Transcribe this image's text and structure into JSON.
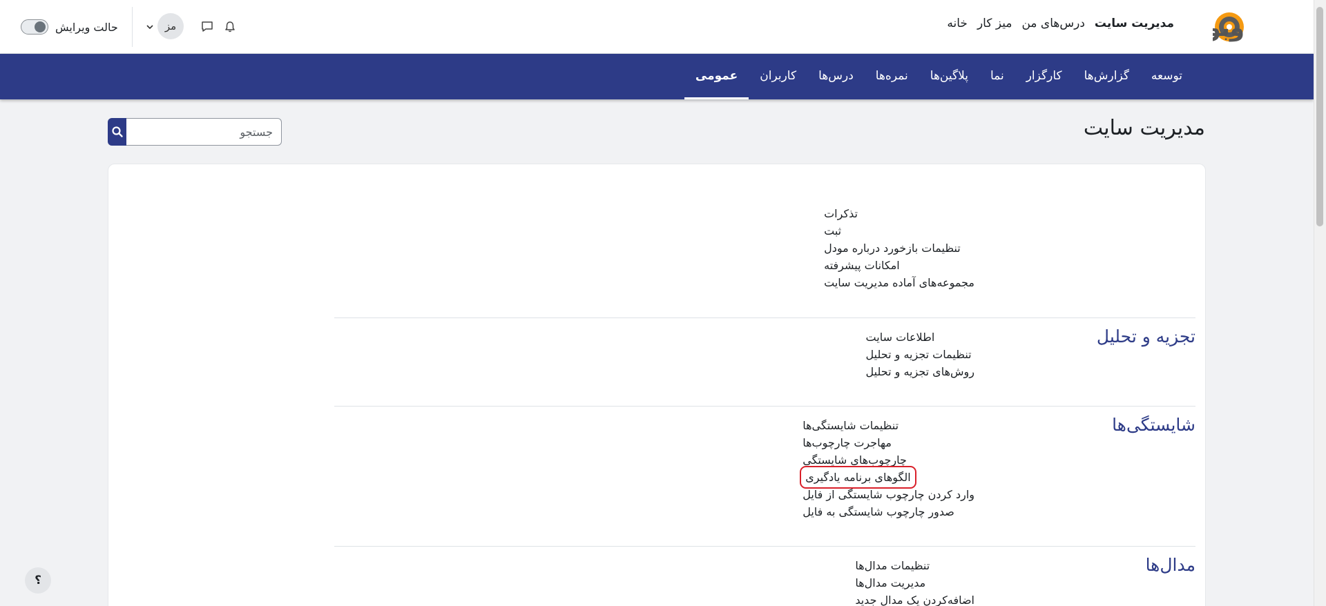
{
  "topbar": {
    "brand": "وبو",
    "nav": [
      "خانه",
      "میز کار",
      "درس‌های من",
      "مدیریت سایت"
    ],
    "nav_active_index": 3,
    "avatar_initials": "مز",
    "edit_mode_label": "حالت ویرایش"
  },
  "secondary_nav": {
    "tabs": [
      "عمومی",
      "کاربران",
      "درس‌ها",
      "نمره‌ها",
      "پلاگین‌ها",
      "نما",
      "کارگزار",
      "گزارش‌ها",
      "توسعه"
    ],
    "active_index": 0
  },
  "page": {
    "title": "مدیریت سایت",
    "search_placeholder": "جستجو"
  },
  "sections": [
    {
      "title": "",
      "links": [
        "تذکرات",
        "ثبت",
        "تنظیمات بازخورد درباره مودل",
        "امکانات پیشرفته",
        "مجموعه‌های آماده مدیریت سایت"
      ]
    },
    {
      "title": "تجزیه و تحلیل",
      "links": [
        "اطلاعات سایت",
        "تنظیمات تجزیه و تحلیل",
        "روش‌های تجزیه و تحلیل"
      ]
    },
    {
      "title": "شایستگی‌ها",
      "links": [
        "تنظیمات شایستگی‌ها",
        "مهاجرت چارچوب‌ها",
        "چارچوب‌های شایستگی",
        "الگوهای برنامه یادگیری",
        "وارد کردن چارچوب شایستگی از فایل",
        "صدور چارچوب شایستگی به فایل"
      ],
      "highlighted_link": "الگوهای برنامه یادگیری"
    },
    {
      "title": "مدال‌ها",
      "links": [
        "تنظیمات مدال‌ها",
        "مدیریت مدال‌ها",
        "اضافه‌کردن یک مدال جدید"
      ]
    }
  ],
  "help_button": "؟",
  "colors": {
    "brand_blue": "#2d3b87",
    "highlight_red": "#d9202a",
    "page_bg": "#f1f2f4"
  },
  "icons": {
    "search": "search-icon",
    "notifications": "bell-icon",
    "messages": "chat-icon",
    "user_menu": "chevron-down-icon",
    "help": "help-icon"
  }
}
